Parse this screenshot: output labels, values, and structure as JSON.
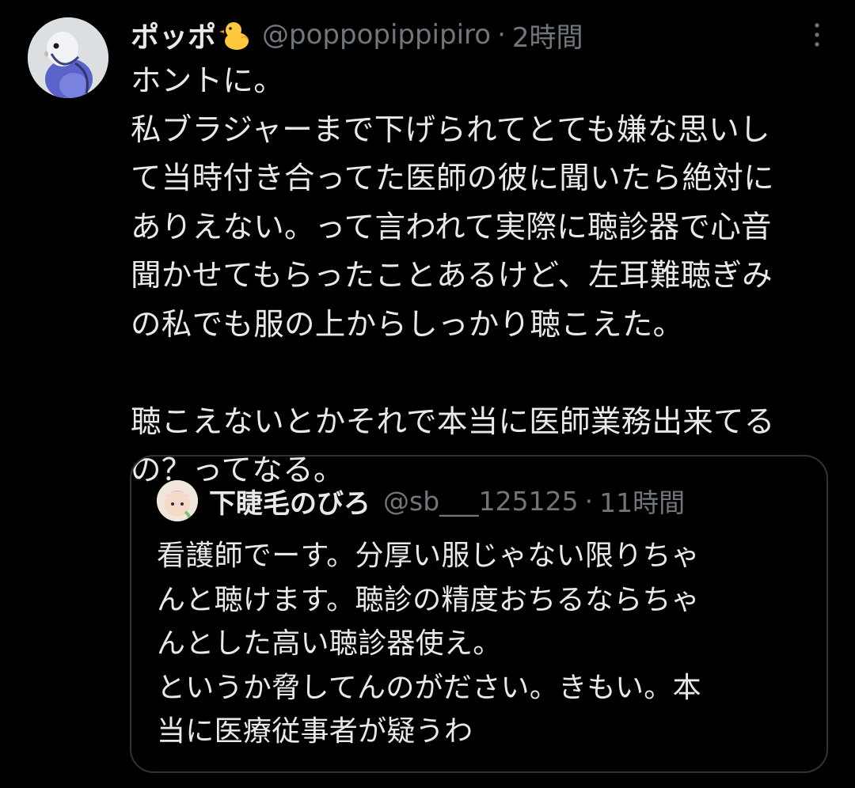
{
  "tweet": {
    "author": {
      "display_name": "ポッポ",
      "name_emoji_icon": "chick-icon",
      "handle": "@poppopippipiro",
      "avatar_icon": "budgie-avatar"
    },
    "separator": "·",
    "time": "2時間",
    "more_icon": "more-vertical-icon",
    "text_lines": [
      "ホントに。",
      "私ブラジャーまで下げられてとても嫌な思いし",
      "て当時付き合ってた医師の彼に聞いたら絶対に",
      "ありえない。って言われて実際に聴診器で心音",
      "聞かせてもらったことあるけど、左耳難聴ぎみ",
      "の私でも服の上からしっかり聴こえた。",
      "",
      "聴こえないとかそれで本当に医師業務出来てる",
      "の？ってなる。"
    ]
  },
  "quoted_tweet": {
    "author": {
      "display_name": "下睫毛のびろ",
      "handle": "@sb___125125",
      "avatar_icon": "character-avatar"
    },
    "separator": "·",
    "time": "11時間",
    "text_lines": [
      "看護師でーす。分厚い服じゃない限りちゃ",
      "んと聴けます。聴診の精度おちるならちゃ",
      "んとした高い聴診器使え。",
      "というか脅してんのがださい。きもい。本",
      "当に医療従事者が疑うわ"
    ]
  },
  "colors": {
    "background": "#000000",
    "text_primary": "#e7e9ea",
    "text_secondary": "#71767b",
    "border": "#2f3336"
  }
}
